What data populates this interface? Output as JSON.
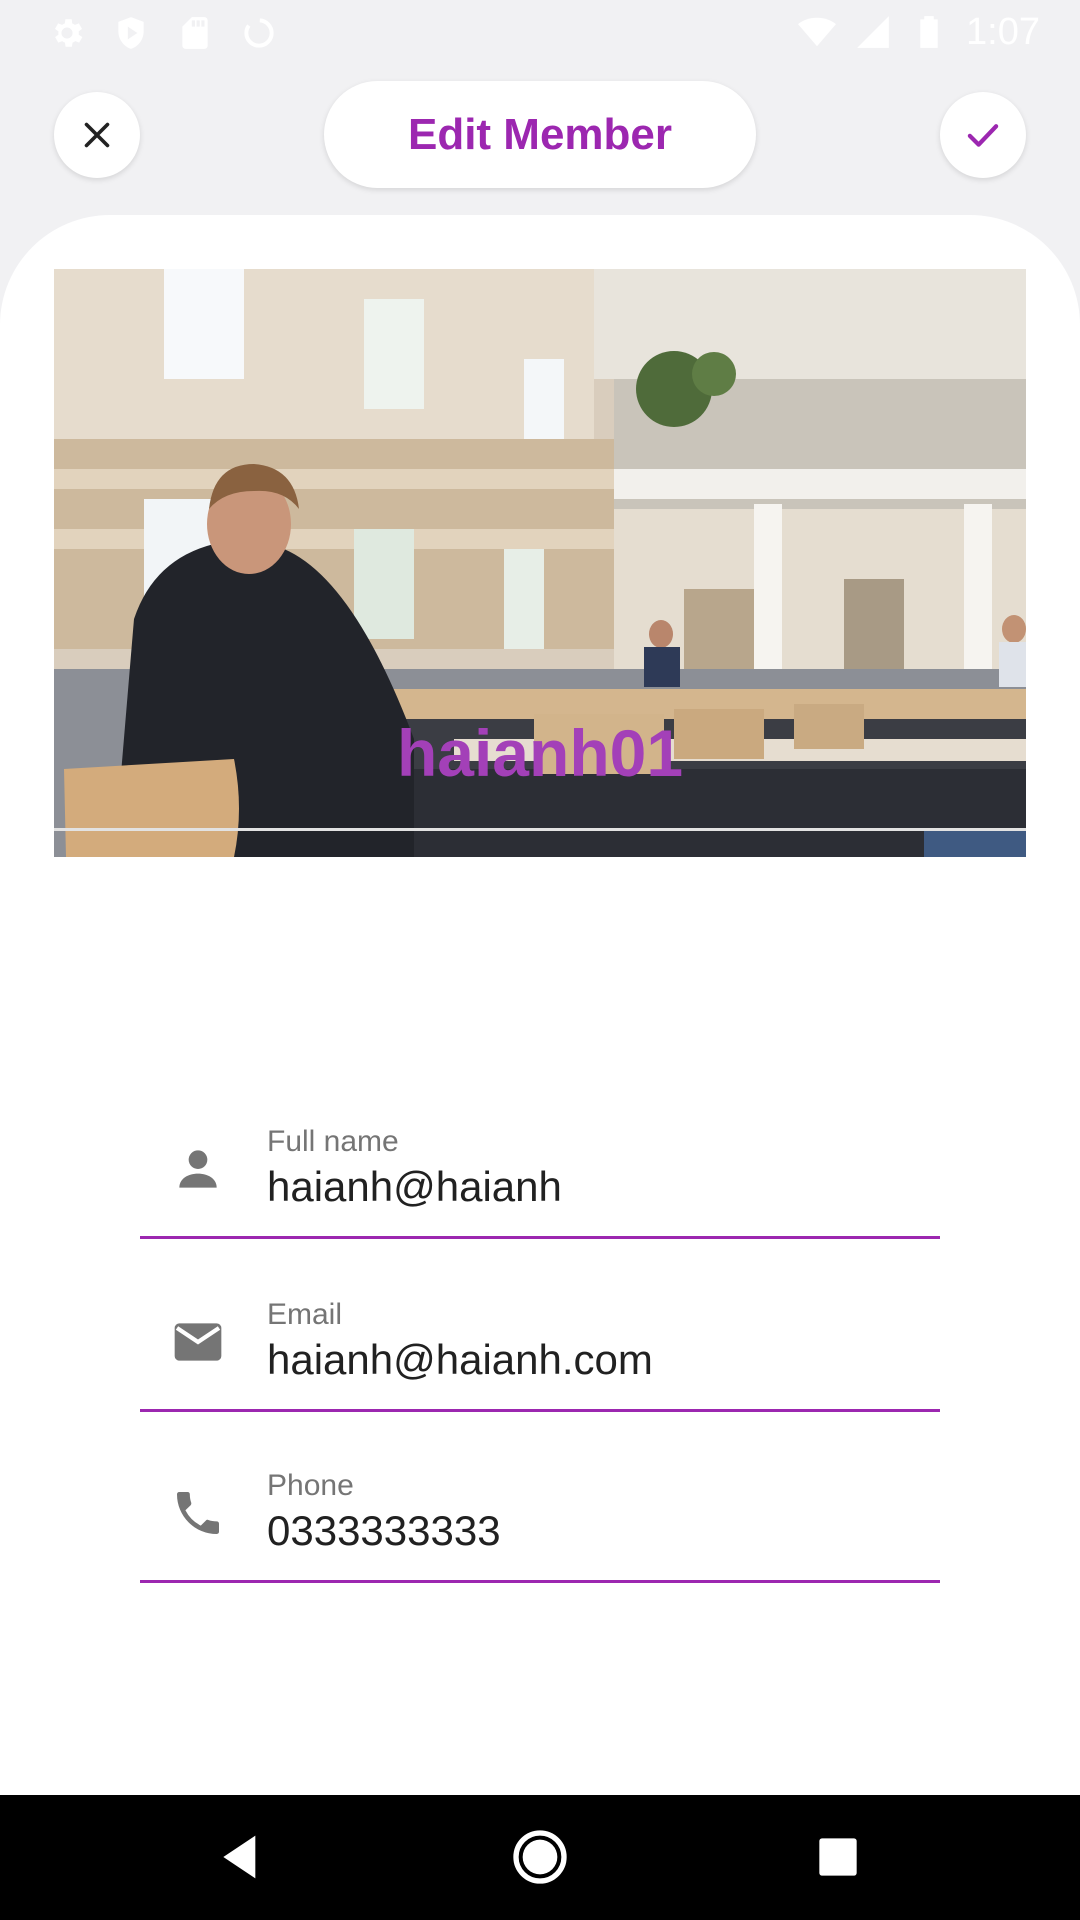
{
  "status_bar": {
    "time": "1:07",
    "left_icons": [
      "settings-icon",
      "shield-icon",
      "sd-card-icon",
      "sync-icon"
    ],
    "right_icons": [
      "wifi-icon",
      "signal-icon",
      "battery-icon"
    ]
  },
  "header": {
    "title": "Edit Member",
    "close_icon": "close-icon",
    "confirm_icon": "check-icon"
  },
  "member": {
    "photo": "library-reading-room-photo",
    "username": "haianh01"
  },
  "form": {
    "full_name": {
      "label": "Full name",
      "value": "haianh@haianh",
      "icon": "person-icon"
    },
    "email": {
      "label": "Email",
      "value": "haianh@haianh.com",
      "icon": "mail-icon"
    },
    "phone": {
      "label": "Phone",
      "value": "0333333333",
      "icon": "phone-icon"
    }
  },
  "colors": {
    "accent": "#9c27b0",
    "username": "#a340b8",
    "background": "#f1f1f3"
  },
  "nav_bar": {
    "buttons": [
      "back-icon",
      "home-icon",
      "recents-icon"
    ]
  }
}
